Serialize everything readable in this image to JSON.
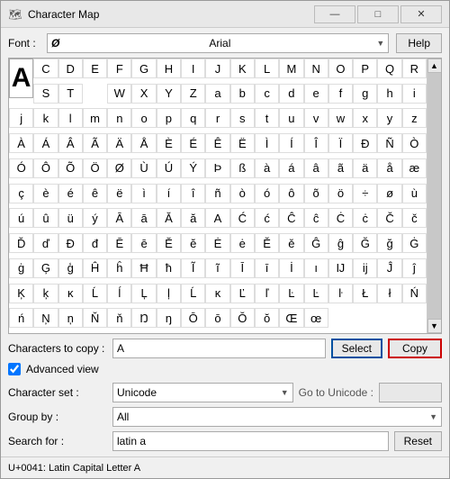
{
  "title_bar": {
    "icon": "🗺",
    "title": "Character Map",
    "minimize_label": "—",
    "maximize_label": "□",
    "close_label": "✕"
  },
  "font_row": {
    "label": "Font :",
    "font_name": "Arial",
    "font_icon": "Ø",
    "help_label": "Help"
  },
  "char_grid": {
    "large_char": "A",
    "rows": [
      [
        "C",
        "D",
        "E",
        "F",
        "G",
        "H",
        "I",
        "J",
        "K",
        "L",
        "M",
        "N",
        "O",
        "P",
        "Q",
        "R",
        "S",
        "T"
      ],
      [
        "W",
        "X",
        "Y",
        "Z",
        "a",
        "b",
        "c",
        "d",
        "e",
        "f",
        "g",
        "h",
        "i",
        "j",
        "k",
        "l",
        "m",
        "n"
      ],
      [
        "o",
        "p",
        "q",
        "r",
        "s",
        "t",
        "u",
        "v",
        "w",
        "x",
        "y",
        "z",
        "À",
        "Á",
        "Â",
        "Ã",
        "Ä",
        "Å"
      ],
      [
        "È",
        "É",
        "Ê",
        "Ë",
        "Ì",
        "Í",
        "Î",
        "Ï",
        "Ð",
        "Ñ",
        "Ò",
        "Ó",
        "Ô",
        "Õ",
        "Ö",
        "Ø",
        "Ù",
        "Ú"
      ],
      [
        "Ý",
        "Þ",
        "ß",
        "à",
        "á",
        "â",
        "ã",
        "ä",
        "å",
        "æ",
        "ç",
        "è",
        "é",
        "ê",
        "ë",
        "ì",
        "í",
        "î"
      ],
      [
        "ñ",
        "ò",
        "ó",
        "ô",
        "õ",
        "ö",
        "÷",
        "ø",
        "ù",
        "ú",
        "û",
        "ü",
        "ý",
        "Ā",
        "ā",
        "Ă",
        "ă",
        "A"
      ],
      [
        "Ć",
        "ć",
        "Ĉ",
        "ĉ",
        "Ċ",
        "ċ",
        "Č",
        "č",
        "Ď",
        "ď",
        "Đ",
        "đ",
        "Ē",
        "ē",
        "Ĕ",
        "ĕ",
        "Ė",
        "ė"
      ],
      [
        "Ě",
        "ě",
        "Ĝ",
        "ĝ",
        "Ğ",
        "ğ",
        "Ġ",
        "ġ",
        "Ģ",
        "ģ",
        "Ĥ",
        "ĥ",
        "Ħ",
        "ħ",
        "Ĩ",
        "ĩ",
        "Ī",
        "ī"
      ],
      [
        "İ",
        "ı",
        "Ĳ",
        "ĳ",
        "Ĵ",
        "ĵ",
        "Ķ",
        "ķ",
        "ĸ",
        "Ĺ",
        "ĺ",
        "Ļ",
        "ļ",
        "Ĺ",
        "ĸ",
        "Ľ",
        "ľ",
        "Ŀ"
      ],
      [
        "Ŀ",
        "ŀ",
        "Ł",
        "ł",
        "Ń",
        "ń",
        "Ņ",
        "ņ",
        "Ň",
        "ň",
        "Ŋ",
        "ŋ",
        "Ō",
        "ō",
        "Ŏ",
        "ŏ",
        "Œ",
        "œ"
      ]
    ]
  },
  "chars_to_copy": {
    "label": "Characters to copy :",
    "value": "A",
    "select_label": "Select",
    "copy_label": "Copy"
  },
  "advanced_view": {
    "label": "Advanced view",
    "checked": true
  },
  "character_set": {
    "label": "Character set :",
    "value": "Unicode",
    "go_to_unicode_label": "Go to Unicode :",
    "go_to_unicode_value": ""
  },
  "group_by": {
    "label": "Group by :",
    "value": "All"
  },
  "search_for": {
    "label": "Search for :",
    "value": "latin a",
    "reset_label": "Reset"
  },
  "status_bar": {
    "text": "U+0041: Latin Capital Letter A"
  }
}
